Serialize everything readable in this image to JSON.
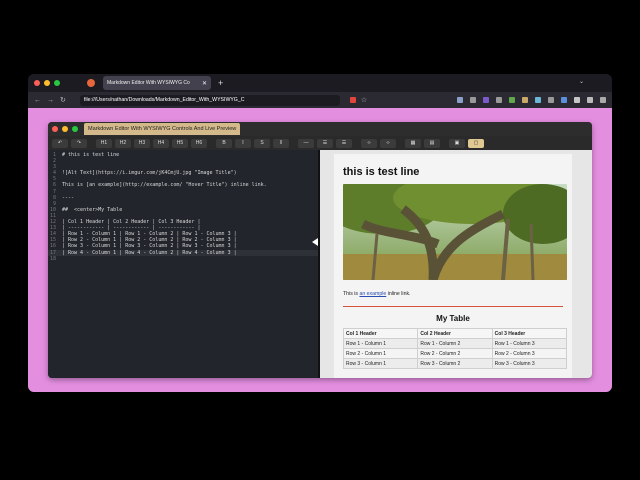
{
  "browser": {
    "tab_title": "Markdown Editor With WYSIWYG Co",
    "url": "file:///Users/nathan/Downloads/Markdown_Editor_With_WYSIWYG_C"
  },
  "editor": {
    "tab_title": "Markdown Editor With WYSIWYG Controls And Live Preview",
    "toolbar": [
      "↶",
      "↷",
      "H1",
      "H2",
      "H3",
      "H4",
      "H5",
      "H6",
      "B",
      "I",
      "S",
      "‖",
      "—",
      "☰",
      "☰",
      "‹›",
      "‹›",
      "▦",
      "▤",
      "▣",
      "▢"
    ],
    "code_lines": [
      {
        "n": "1",
        "text": "# this is test line"
      },
      {
        "n": "2",
        "text": ""
      },
      {
        "n": "3",
        "text": ""
      },
      {
        "n": "4",
        "text": "![Alt Text](https://i.imgur.com/jK4CmjU.jpg \"Image Title\")"
      },
      {
        "n": "5",
        "text": ""
      },
      {
        "n": "6",
        "text": "This is [an example](http://example.com/ \"Hover Title\") inline link."
      },
      {
        "n": "7",
        "text": ""
      },
      {
        "n": "8",
        "text": "----"
      },
      {
        "n": "9",
        "text": ""
      },
      {
        "n": "10",
        "text": "##  <center>My Table"
      },
      {
        "n": "11",
        "text": ""
      },
      {
        "n": "12",
        "text": "| Col 1 Header | Col 2 Header | Col 3 Header |"
      },
      {
        "n": "13",
        "text": "| ------------ | ------------ | ------------ |"
      },
      {
        "n": "14",
        "text": "| Row 1 - Column 1 | Row 1 - Column 2 | Row 1 - Column 3 |"
      },
      {
        "n": "15",
        "text": "| Row 2 - Column 1 | Row 2 - Column 2 | Row 2 - Column 3 |"
      },
      {
        "n": "16",
        "text": "| Row 3 - Column 1 | Row 3 - Column 2 | Row 3 - Column 3 |"
      },
      {
        "n": "17",
        "text": "| Row 4 - Column 1 | Row 4 - Column 2 | Row 4 - Column 3 |"
      },
      {
        "n": "18",
        "text": ""
      }
    ]
  },
  "preview": {
    "heading": "this is test line",
    "para_before": "This is ",
    "link_text": "an example",
    "para_after": " inline link.",
    "table_title": "My Table",
    "table_headers": [
      "Col 1 Header",
      "Col 2 Header",
      "Col 3 Header"
    ],
    "table_rows": [
      [
        "Row 1 - Column 1",
        "Row 1 - Column 2",
        "Row 1 - Column 3"
      ],
      [
        "Row 2 - Column 1",
        "Row 2 - Column 2",
        "Row 2 - Column 3"
      ],
      [
        "Row 3 - Column 1",
        "Row 3 - Column 2",
        "Row 3 - Column 3"
      ]
    ]
  }
}
